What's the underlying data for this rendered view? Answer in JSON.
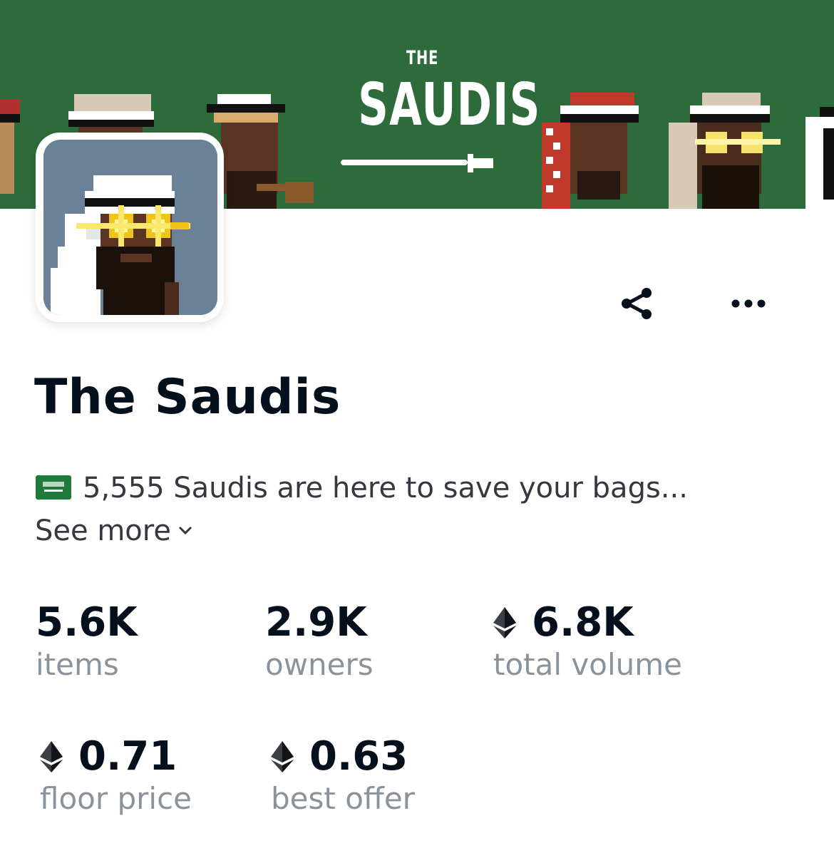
{
  "banner": {
    "title_small": "THE",
    "title_big": "SAUDIS",
    "background_color": "#2e6b3b"
  },
  "collection": {
    "name": "The Saudis",
    "description": "5,555 Saudis are here to save your bags...",
    "see_more_label": "See more"
  },
  "actions": {
    "share_icon": "share-icon",
    "more_icon": "more-horizontal-icon"
  },
  "stats": [
    {
      "value": "5.6K",
      "label": "items",
      "eth": false
    },
    {
      "value": "2.9K",
      "label": "owners",
      "eth": false
    },
    {
      "value": "6.8K",
      "label": "total volume",
      "eth": true
    },
    {
      "value": "0.71",
      "label": "floor price",
      "eth": true
    },
    {
      "value": "0.63",
      "label": "best offer",
      "eth": true
    }
  ],
  "colors": {
    "text_primary": "#04111d",
    "text_secondary": "#8a939b",
    "avatar_background": "#6a8197"
  }
}
